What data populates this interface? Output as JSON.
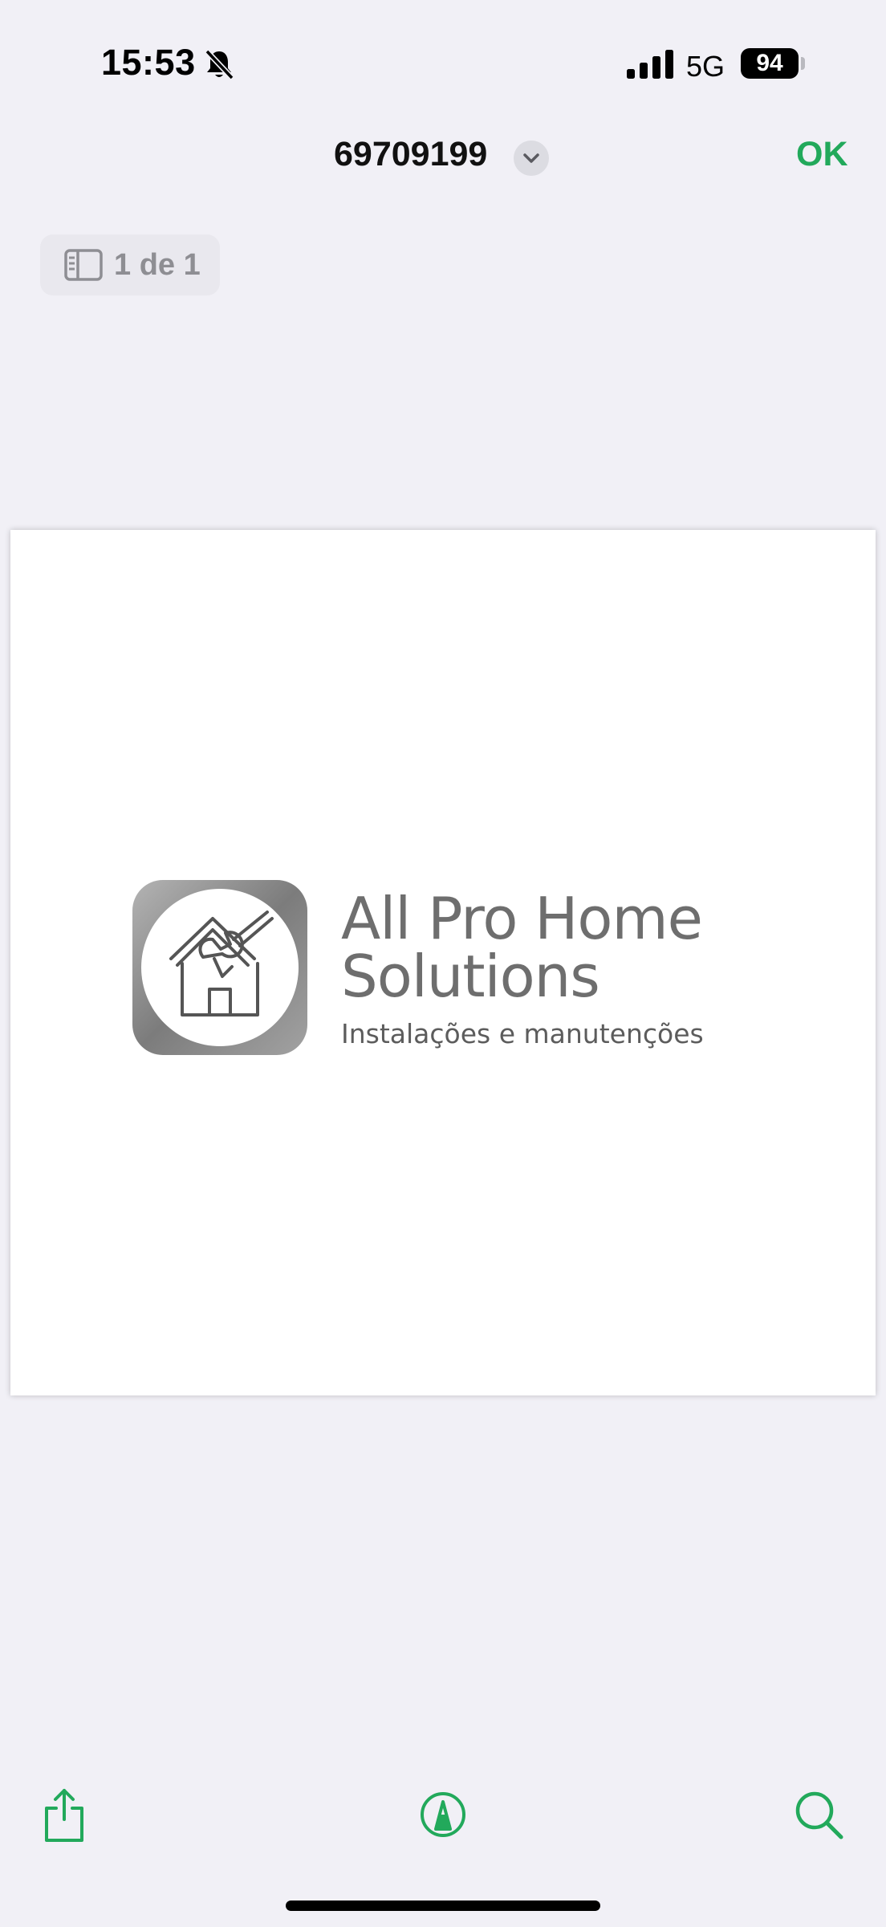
{
  "status_bar": {
    "time": "15:53",
    "network": "5G",
    "battery": "94"
  },
  "nav": {
    "title": "69709199",
    "done_label": "OK"
  },
  "page_indicator": {
    "label": "1 de 1"
  },
  "document": {
    "brand_line1": "All Pro Home",
    "brand_line2": "Solutions",
    "tagline": "Instalações e manutenções"
  },
  "toolbar": {
    "items": [
      "share-icon",
      "markup-icon",
      "search-icon"
    ]
  },
  "colors": {
    "accent": "#22a95b",
    "background": "#f1f0f6"
  }
}
